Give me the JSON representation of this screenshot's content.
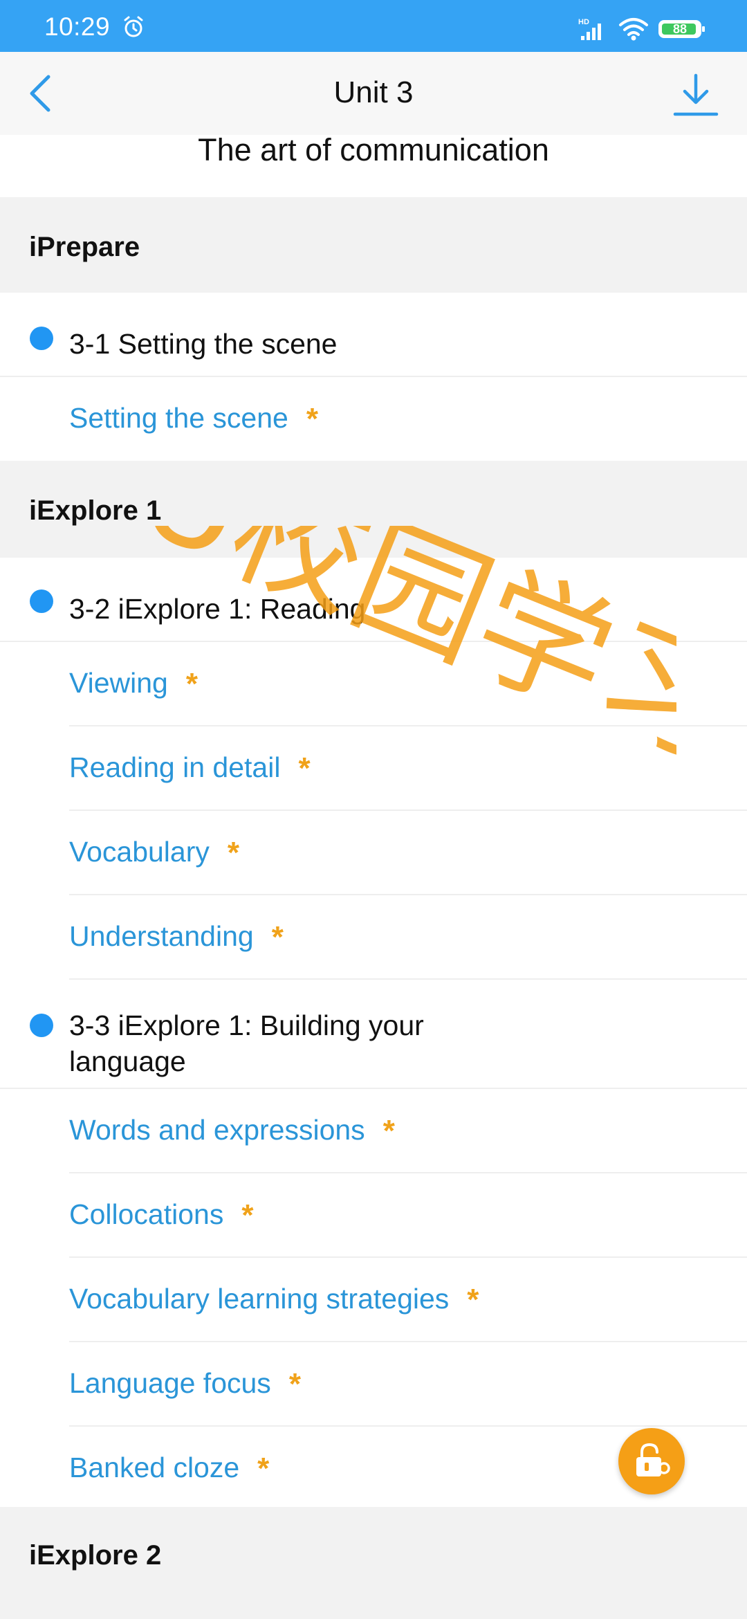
{
  "status": {
    "time": "10:29",
    "network": "HD",
    "battery": "88"
  },
  "header": {
    "title": "Unit 3",
    "subtitle": "The art of communication"
  },
  "sections": [
    {
      "title": "iPrepare",
      "lessons": [
        {
          "title": "3-1 Setting the scene",
          "activities": [
            "Setting the scene"
          ]
        }
      ]
    },
    {
      "title": "iExplore 1",
      "lessons": [
        {
          "title": "3-2 iExplore 1: Reading",
          "activities": [
            "Viewing",
            "Reading in detail",
            "Vocabulary",
            "Understanding"
          ]
        },
        {
          "title": "3-3 iExplore 1: Building your language",
          "activities": [
            "Words and expressions",
            "Collocations",
            "Vocabulary learning strategies",
            "Language focus",
            "Banked cloze"
          ]
        }
      ]
    },
    {
      "title": "iExplore 2"
    }
  ],
  "activity_marker": "*",
  "watermark": "U校园学习",
  "colors": {
    "status_bar": "#35a3f4",
    "accent_blue": "#2196f3",
    "link_blue": "#2a95d8",
    "star_orange": "#f0a21a",
    "fab_orange": "#f59f16",
    "watermark_orange": "#f59f16"
  },
  "icons": {
    "back": "chevron-left-icon",
    "download": "download-icon",
    "lock": "lock-key-icon",
    "alarm": "alarm-icon",
    "signal": "signal-icon",
    "wifi": "wifi-icon"
  }
}
